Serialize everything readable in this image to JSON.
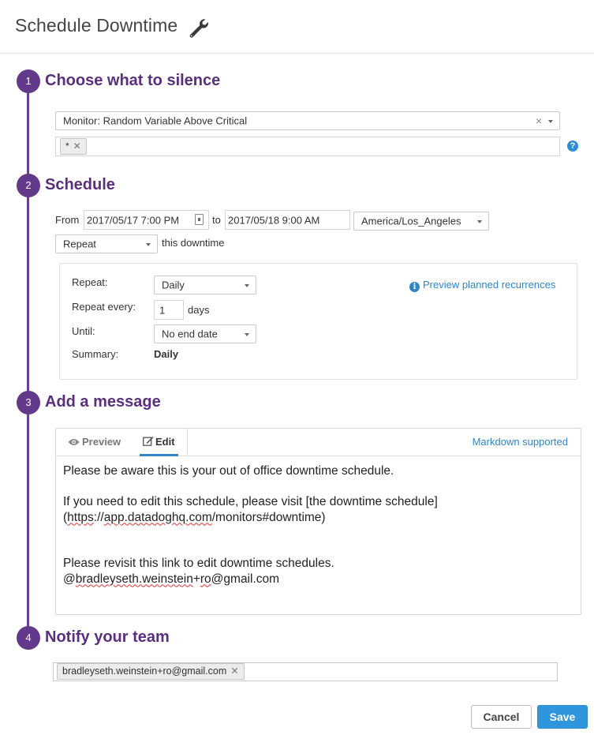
{
  "header": {
    "title": "Schedule Downtime",
    "icon": "wrench-icon"
  },
  "steps": [
    {
      "number": "1",
      "title": "Choose what to silence"
    },
    {
      "number": "2",
      "title": "Schedule"
    },
    {
      "number": "3",
      "title": "Add a message"
    },
    {
      "number": "4",
      "title": "Notify your team"
    }
  ],
  "silence": {
    "monitor_select": "Monitor: Random Variable Above Critical",
    "scope_tag": "*",
    "help_icon": "question-icon"
  },
  "schedule": {
    "from_label": "From",
    "from_value": "2017/05/17 7:00 PM",
    "to_label": "to",
    "to_value": "2017/05/18 9:00 AM",
    "timezone": "America/Los_Angeles",
    "repeat_select": "Repeat",
    "repeat_suffix": "this downtime",
    "recurrence": {
      "repeat_label": "Repeat:",
      "repeat_value": "Daily",
      "every_label": "Repeat every:",
      "every_value": "1",
      "every_unit": "days",
      "until_label": "Until:",
      "until_value": "No end date",
      "summary_label": "Summary:",
      "summary_value": "Daily",
      "preview_link": "Preview planned recurrences"
    }
  },
  "message": {
    "tab_preview": "Preview",
    "tab_edit": "Edit",
    "markdown_link": "Markdown supported",
    "line1": "Please be aware this is your out of office downtime schedule.",
    "line3": "If you need to edit this schedule, please visit [the downtime schedule]",
    "line4_prefix": "(",
    "line4_https": "https",
    "line4_mid1": "://",
    "line4_domain": "app.datadoghq.com",
    "line4_rest": "/monitors#downtime)",
    "line7": "Please revisit this link to edit downtime schedules.",
    "line8_at": "@",
    "line8_user": "bradleyseth.weinstein",
    "line8_plus": "+",
    "line8_ro": "ro",
    "line8_domain": "@gmail.com"
  },
  "notify": {
    "recipient_tag": "bradleyseth.weinstein+ro@gmail.com"
  },
  "actions": {
    "cancel_label": "Cancel",
    "save_label": "Save"
  },
  "colors": {
    "accent_purple": "#633a8b",
    "link_blue": "#2f86c6",
    "save_blue": "#2f96dd"
  }
}
